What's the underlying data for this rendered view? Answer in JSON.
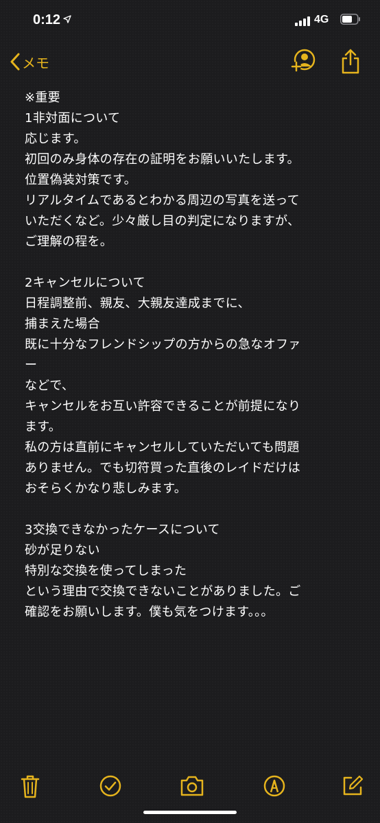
{
  "status_bar": {
    "time": "0:12",
    "network": "4G"
  },
  "nav": {
    "back_label": "メモ",
    "accent_color": "#e6b41d"
  },
  "note": {
    "lines": [
      "※重要",
      "1非対面について",
      "応じます。",
      "初回のみ身体の存在の証明をお願いいたします。",
      "位置偽装対策です。",
      "リアルタイムであるとわかる周辺の写真を送って",
      "いただくなど。少々厳し目の判定になりますが、",
      "ご理解の程を。",
      "",
      "2キャンセルについて",
      "日程調整前、親友、大親友達成までに、",
      "捕まえた場合",
      "既に十分なフレンドシップの方からの急なオファ",
      "ー",
      "などで、",
      "キャンセルをお互い許容できることが前提になり",
      "ます。",
      "私の方は直前にキャンセルしていただいても問題",
      "ありません。でも切符買った直後のレイドだけは",
      "おそらくかなり悲しみます。",
      "",
      "3交換できなかったケースについて",
      "砂が足りない",
      "特別な交換を使ってしまった",
      "という理由で交換できないことがありました。ご",
      "確認をお願いします。僕も気をつけます。。。"
    ]
  },
  "toolbar": {
    "icons": [
      "trash-icon",
      "checklist-icon",
      "camera-icon",
      "markup-icon",
      "compose-icon"
    ]
  }
}
